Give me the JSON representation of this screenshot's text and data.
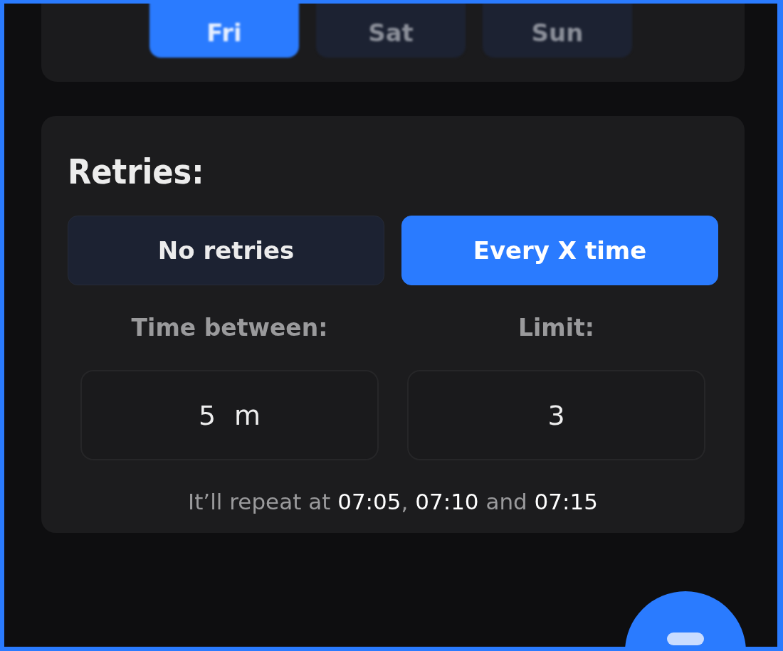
{
  "days": [
    {
      "label": "Fri",
      "selected": true
    },
    {
      "label": "Sat",
      "selected": false
    },
    {
      "label": "Sun",
      "selected": false
    }
  ],
  "retries": {
    "title": "Retries:",
    "options": [
      {
        "label": "No retries",
        "selected": false
      },
      {
        "label": "Every X time",
        "selected": true
      }
    ],
    "fields": [
      {
        "label": "Time between:",
        "value": "5",
        "unit": "m"
      },
      {
        "label": "Limit:",
        "value": "3"
      }
    ],
    "summary": "It’ll repeat at **07:05**, **07:10** and **07:15**"
  }
}
